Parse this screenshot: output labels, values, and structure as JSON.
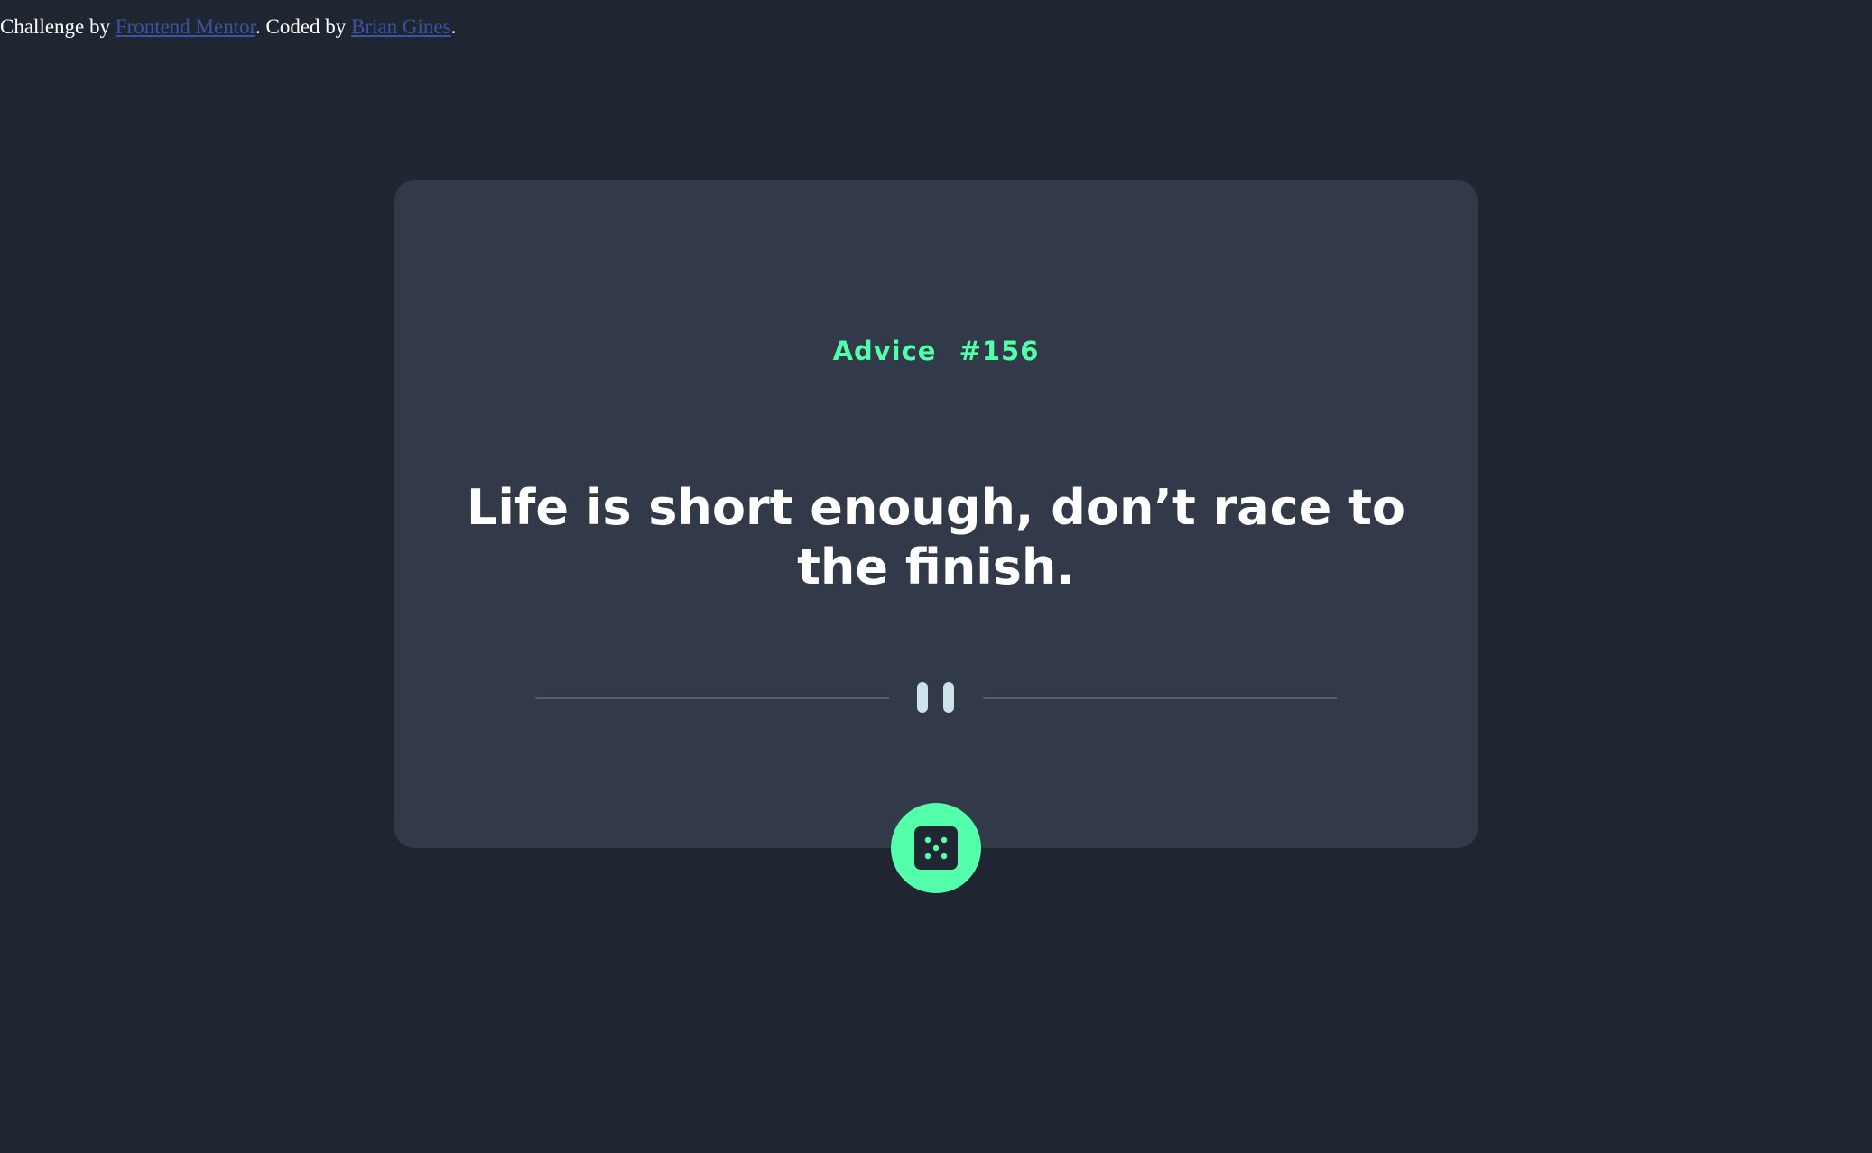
{
  "attribution": {
    "prefix": "Challenge by ",
    "link1": "Frontend Mentor",
    "middle": ". Coded by ",
    "link2": "Brian Gines",
    "suffix": "."
  },
  "card": {
    "advice_label": "Advice",
    "advice_number": "#156",
    "quote": "Life is short enough, don’t race to the finish."
  },
  "icons": {
    "divider": "pause-divider-icon",
    "button": "dice-icon"
  },
  "colors": {
    "background": "#1f2632",
    "card": "#323a4a",
    "accent": "#53ffaa",
    "text": "#ffffff",
    "link": "#3e52a3",
    "divider_line": "#4f5d74",
    "pause_bars": "#cee3e9"
  }
}
